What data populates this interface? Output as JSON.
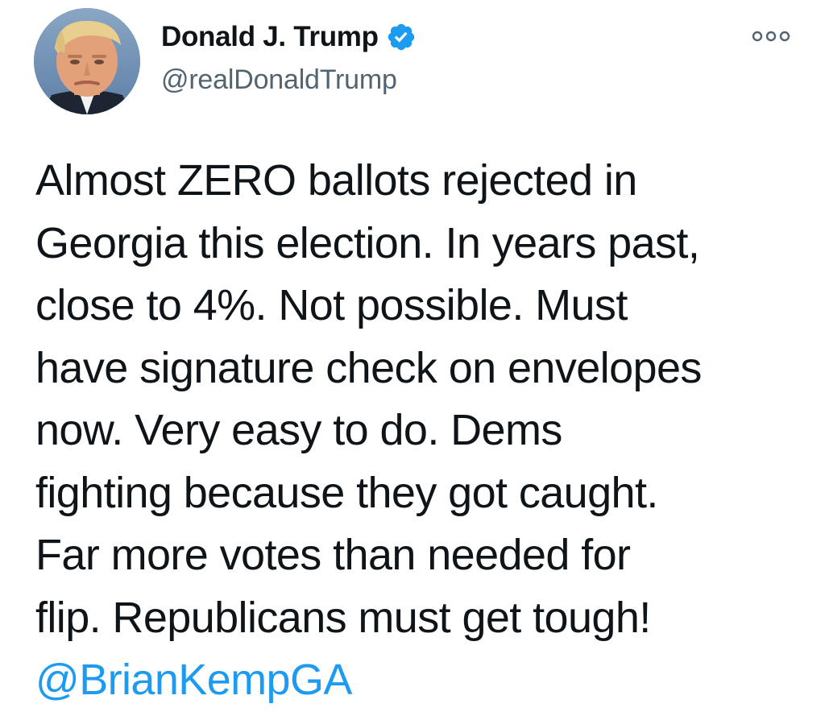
{
  "author": {
    "display_name": "Donald J. Trump",
    "handle": "@realDonaldTrump",
    "verified": true,
    "avatar_icon": "profile-photo"
  },
  "actions": {
    "more_icon": "more-options-icon"
  },
  "tweet": {
    "lines": [
      "Almost ZERO ballots rejected in",
      "Georgia this election. In years past,",
      "close to 4%. Not possible. Must",
      "have signature check on envelopes",
      "now. Very easy to do. Dems",
      "fighting because they got caught.",
      "Far more votes than needed for",
      "flip. Republicans must get tough!"
    ],
    "mention": "@BrianKempGA"
  },
  "colors": {
    "text": "#0f1419",
    "secondary_text": "#536471",
    "accent": "#1d9bf0",
    "background": "#ffffff"
  }
}
